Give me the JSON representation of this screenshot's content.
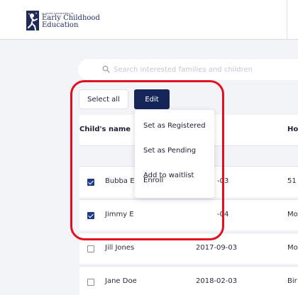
{
  "header": {
    "logo_small": "ALABAMA DEPARTMENT OF",
    "logo_line1": "Early Childhood",
    "logo_line2": "Education"
  },
  "search": {
    "placeholder": "Search interested families and children"
  },
  "toolbar": {
    "select_all_label": "Select all",
    "edit_label": "Edit"
  },
  "table": {
    "headers": {
      "name": "Child's name",
      "home": "Ho"
    },
    "rows": [
      {
        "checked": true,
        "name": "Bubba E",
        "dob": "-03",
        "home": "51"
      },
      {
        "checked": true,
        "name": "Jimmy E",
        "dob": "-04",
        "home": "Mo"
      },
      {
        "checked": false,
        "name": "Jill Jones",
        "dob": "2017-09-03",
        "home": "Mo"
      },
      {
        "checked": false,
        "name": "Jane Doe",
        "dob": "2018-02-03",
        "home": "Bir"
      }
    ]
  },
  "edit_menu": {
    "items": [
      "Set as Registered",
      "Set as Pending",
      "Add to waitlist",
      "Enroll"
    ]
  },
  "colors": {
    "primary": "#162558",
    "highlight": "#e0101e",
    "checkbox": "#1f3a8a"
  },
  "icons": {
    "logo": "child-running-logo-icon",
    "search": "search-icon"
  }
}
